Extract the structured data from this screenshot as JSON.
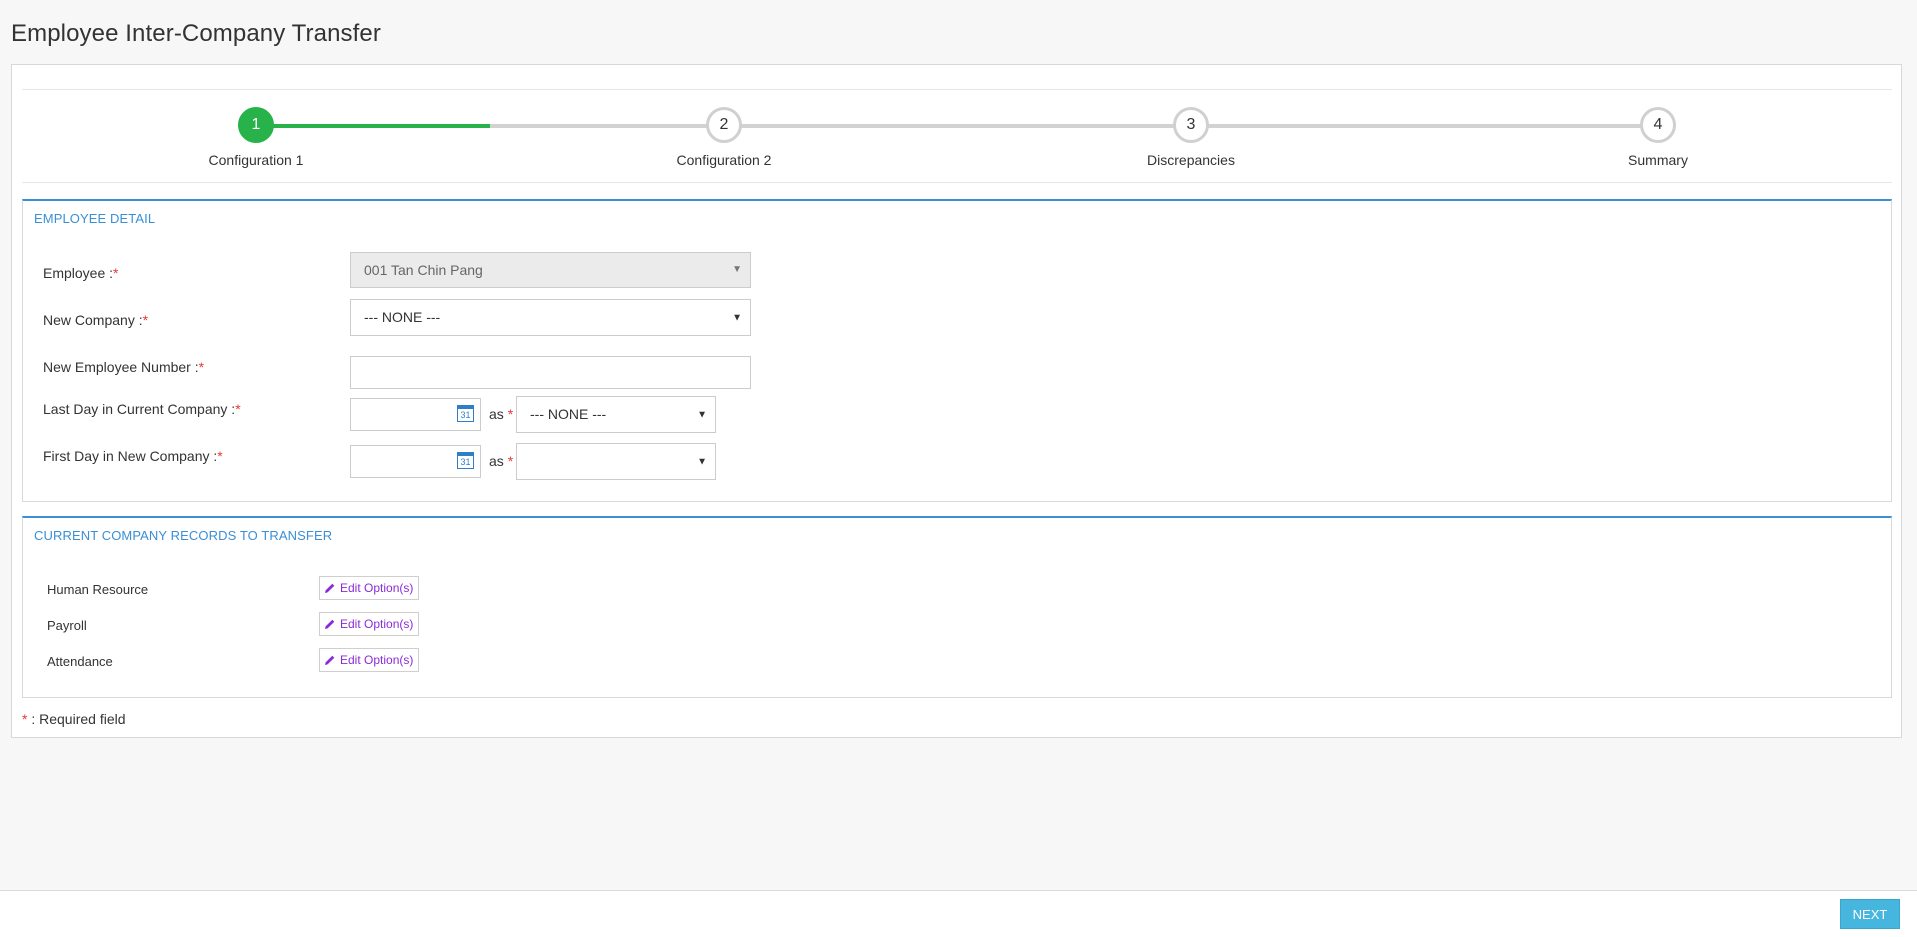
{
  "page": {
    "title": "Employee Inter-Company Transfer"
  },
  "wizard": {
    "steps": [
      {
        "number": "1",
        "label": "Configuration 1",
        "active": true
      },
      {
        "number": "2",
        "label": "Configuration 2",
        "active": false
      },
      {
        "number": "3",
        "label": "Discrepancies",
        "active": false
      },
      {
        "number": "4",
        "label": "Summary",
        "active": false
      }
    ],
    "progress_color": "#27b34a"
  },
  "employee_detail": {
    "title": "EMPLOYEE DETAIL",
    "employee": {
      "label": "Employee :",
      "value": "001 Tan Chin Pang"
    },
    "new_company": {
      "label": "New Company :",
      "value": "--- NONE ---"
    },
    "new_employee_number": {
      "label": "New Employee Number :",
      "value": ""
    },
    "last_day": {
      "label": "Last Day in Current Company :",
      "date": "",
      "as_label": "as",
      "as_value": "--- NONE ---"
    },
    "first_day": {
      "label": "First Day in New Company :",
      "date": "",
      "as_label": "as",
      "as_value": ""
    },
    "required_mark": "*"
  },
  "records": {
    "title": "CURRENT COMPANY RECORDS TO TRANSFER",
    "items": [
      {
        "label": "Human Resource",
        "button": "Edit Option(s)"
      },
      {
        "label": "Payroll",
        "button": "Edit Option(s)"
      },
      {
        "label": "Attendance",
        "button": "Edit Option(s)"
      }
    ]
  },
  "required_note": {
    "mark": "*",
    "text": " : Required field"
  },
  "calendar_icon_text": "31",
  "footer": {
    "next_label": "NEXT"
  },
  "colors": {
    "accent": "#3a8fd6",
    "success": "#27b34a",
    "next_button": "#47b6de",
    "required": "#e53935",
    "edit_link": "#8b2bd8"
  }
}
